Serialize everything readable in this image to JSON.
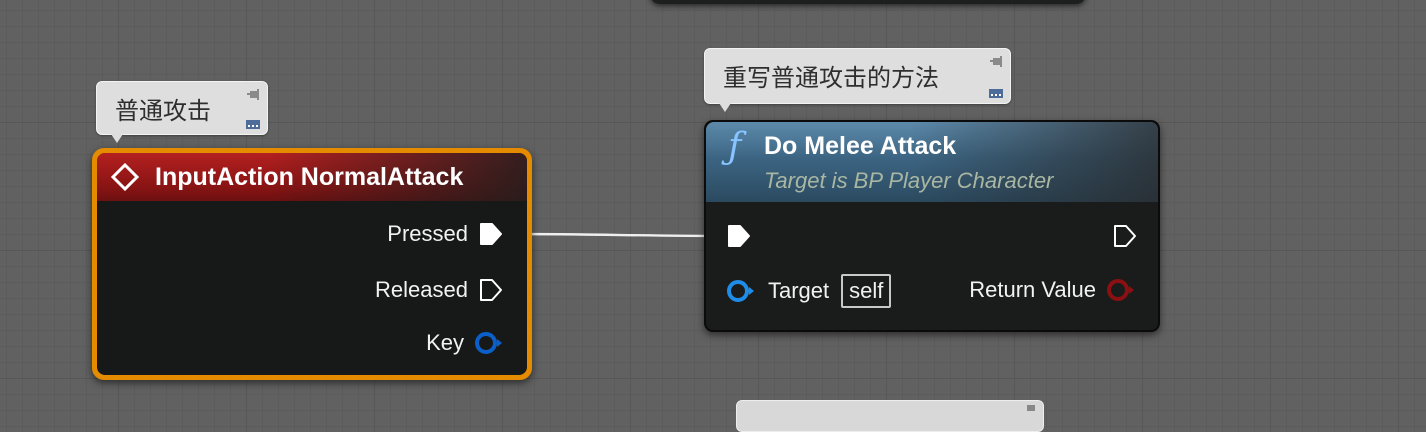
{
  "colors": {
    "event_header": "#a31818",
    "selected_outline": "#e48b00",
    "function_header": "#3c6583",
    "exec_pin": "#ffffff",
    "object_pin": "#1f8de8",
    "return_pin": "#8c0f12",
    "comment_bubble": "#dedede"
  },
  "comments": {
    "input_comment": "普通攻击",
    "function_comment": "重写普通攻击的方法"
  },
  "input_node": {
    "title": "InputAction NormalAttack",
    "icon": "event-diamond-icon",
    "outputs": {
      "pressed": "Pressed",
      "released": "Released",
      "key": "Key"
    }
  },
  "function_node": {
    "title": "Do Melee Attack",
    "subtitle": "Target is BP Player Character",
    "icon": "function-f-icon",
    "target_label": "Target",
    "target_value": "self",
    "return_label": "Return Value"
  }
}
